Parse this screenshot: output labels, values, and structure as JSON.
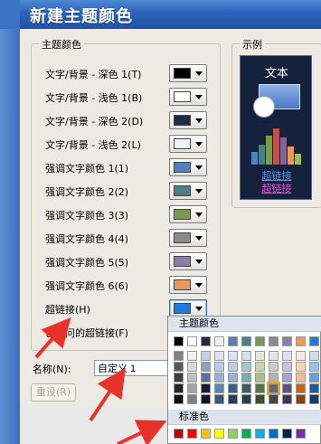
{
  "window": {
    "title": "新建主题颜色"
  },
  "theme_group": {
    "title": "主题颜色",
    "rows": [
      {
        "label": "文字/背景 - 深色 1(T)",
        "color": "#000000"
      },
      {
        "label": "文字/背景 - 浅色 1(B)",
        "color": "#ffffff"
      },
      {
        "label": "文字/背景 - 深色 2(D)",
        "color": "#1f2a44"
      },
      {
        "label": "文字/背景 - 浅色 2(L)",
        "color": "#eef3f8"
      },
      {
        "label": "强调文字颜色 1(1)",
        "color": "#4f81bd"
      },
      {
        "label": "强调文字颜色 2(2)",
        "color": "#4a7f8a"
      },
      {
        "label": "强调文字颜色 3(3)",
        "color": "#7a9a4c"
      },
      {
        "label": "强调文字颜色 4(4)",
        "color": "#8a8a8a"
      },
      {
        "label": "强调文字颜色 5(5)",
        "color": "#8b7ea8"
      },
      {
        "label": "强调文字颜色 6(6)",
        "color": "#e8995a"
      },
      {
        "label": "超链接(H)",
        "color": "#1e7ce0"
      },
      {
        "label": "已访问的超链接(F)",
        "color": "#a33ac9"
      }
    ]
  },
  "sample_group": {
    "title": "示例",
    "text": "文本",
    "link": "超链接",
    "visited_link": "超链接",
    "bar_colors": [
      "#4f81bd",
      "#4a7f8a",
      "#7a9a4c",
      "#c0504d",
      "#8064a2",
      "#e8995a",
      "#9bbb59"
    ]
  },
  "name_field": {
    "label": "名称(N):",
    "value": "自定义 1"
  },
  "reset_button": {
    "label": "重设(R)"
  },
  "palette": {
    "theme_header": "主题颜色",
    "standard_header": "标准色",
    "theme_top_row": [
      "#000000",
      "#ffffff",
      "#1f2a44",
      "#eef3f8",
      "#4f81bd",
      "#4a7f8a",
      "#7a9a4c",
      "#8a8a8a",
      "#8b7ea8",
      "#e8995a",
      "#1e7ce0"
    ],
    "theme_shades": [
      [
        "#7f7f7f",
        "#f2f2f2",
        "#c6d0e3",
        "#dbe5f1",
        "#dbe5f1",
        "#d2e3e6",
        "#e2ebd4",
        "#e5e5e5",
        "#e3dff0",
        "#fbe9da",
        "#c8e0fa"
      ],
      [
        "#595959",
        "#d8d8d8",
        "#8ea1c7",
        "#b7cce3",
        "#b8cce4",
        "#a5c8cd",
        "#c6d7aa",
        "#cccccc",
        "#c8c0e0",
        "#f7d3b5",
        "#92c2f4"
      ],
      [
        "#3f3f3f",
        "#bfbfbf",
        "#5572ab",
        "#94b2d5",
        "#95b3d7",
        "#79acb4",
        "#aac47f",
        "#b2b2b2",
        "#aca0d1",
        "#f3bd90",
        "#5ba3ef"
      ],
      [
        "#262626",
        "#a5a5a5",
        "#172033",
        "#5d85b4",
        "#366092",
        "#375f67",
        "#5b7339",
        "#686868",
        "#5e5383",
        "#c5661d",
        "#135ca8"
      ],
      [
        "#0c0c0c",
        "#7f7f7f",
        "#0f1522",
        "#3b5876",
        "#244061",
        "#253f45",
        "#3d4d26",
        "#454545",
        "#3f3757",
        "#834413",
        "#0c3d70"
      ]
    ],
    "standard_colors": [
      "#c00000",
      "#ff0000",
      "#ffc000",
      "#ffff00",
      "#92d050",
      "#00b050",
      "#00b0f0",
      "#0070c0",
      "#002060",
      "#7030a0"
    ]
  }
}
